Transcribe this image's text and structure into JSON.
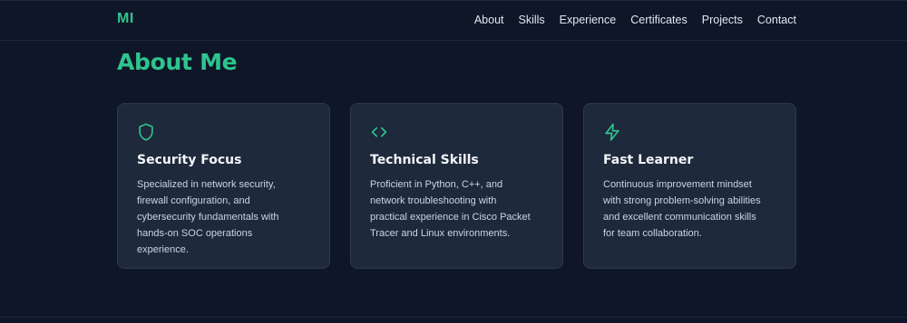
{
  "header": {
    "logo": "MI",
    "nav": [
      "About",
      "Skills",
      "Experience",
      "Certificates",
      "Projects",
      "Contact"
    ]
  },
  "section": {
    "title": "About Me"
  },
  "cards": [
    {
      "icon": "shield-icon",
      "title": "Security Focus",
      "lines": [
        "Specialized in network security,",
        "firewall configuration, and",
        "cybersecurity fundamentals with",
        "hands-on SOC operations",
        "experience."
      ]
    },
    {
      "icon": "code-icon",
      "title": "Technical Skills",
      "lines": [
        "Proficient in Python, C++, and",
        "network troubleshooting with",
        "practical experience in Cisco Packet",
        "Tracer and Linux environments."
      ]
    },
    {
      "icon": "lightning-icon",
      "title": "Fast Learner",
      "lines": [
        "Continuous improvement mindset",
        "with strong problem-solving abilities",
        "and excellent communication skills",
        "for team collaboration."
      ]
    }
  ],
  "colors": {
    "accent": "#2fc48d",
    "background": "#0e1628",
    "card": "#1e293b"
  }
}
